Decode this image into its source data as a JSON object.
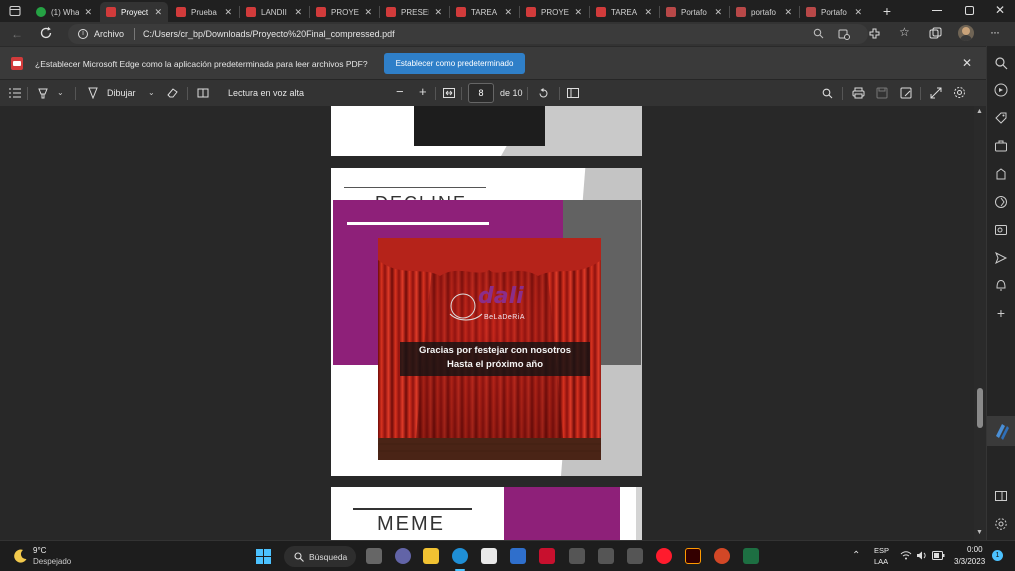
{
  "tabs": [
    {
      "title": "(1) Wha",
      "icon": "whatsapp-icon",
      "color": "#25a244",
      "active": false
    },
    {
      "title": "Proyect",
      "icon": "pdf-icon",
      "color": "#d13b3b",
      "active": true
    },
    {
      "title": "Prueba",
      "icon": "pdf-icon",
      "color": "#d13b3b",
      "active": false
    },
    {
      "title": "LANDII",
      "icon": "pdf-icon",
      "color": "#d13b3b",
      "active": false
    },
    {
      "title": "PROYE",
      "icon": "pdf-icon",
      "color": "#d13b3b",
      "active": false
    },
    {
      "title": "PRESEI",
      "icon": "pdf-icon",
      "color": "#d13b3b",
      "active": false
    },
    {
      "title": "TAREA",
      "icon": "pdf-icon",
      "color": "#d13b3b",
      "active": false
    },
    {
      "title": "PROYE",
      "icon": "pdf-icon",
      "color": "#d13b3b",
      "active": false
    },
    {
      "title": "TAREA",
      "icon": "pdf-icon",
      "color": "#d13b3b",
      "active": false
    },
    {
      "title": "Portafo",
      "icon": "shield-icon",
      "color": "#b84848",
      "active": false
    },
    {
      "title": "portafo",
      "icon": "shield-icon",
      "color": "#b84848",
      "active": false
    },
    {
      "title": "Portafo",
      "icon": "shield-icon",
      "color": "#b84848",
      "active": false
    }
  ],
  "address": {
    "scheme_label": "Archivo",
    "url": "C:/Users/cr_bp/Downloads/Proyecto%20Final_compressed.pdf"
  },
  "infobar": {
    "message": "¿Establecer Microsoft Edge como la aplicación predeterminada para leer archivos PDF?",
    "button_label": "Establecer como predeterminado"
  },
  "pdf_toolbar": {
    "draw_label": "Dibujar",
    "read_aloud_label": "Lectura en voz alta",
    "current_page": "8",
    "page_of": "de 10"
  },
  "pages": {
    "page8_heading": "DECLINE",
    "poster_brand": "BeLaDeRiA",
    "poster_logo_word": "dali",
    "poster_line1": "Gracias por festejar con nosotros",
    "poster_line2": "Hasta el próximo año",
    "page9_heading": "MEME"
  },
  "taskbar": {
    "weather_temp": "9°C",
    "weather_desc": "Despejado",
    "search_label": "Búsqueda",
    "lang_top": "ESP",
    "lang_bottom": "LAA",
    "time": "0:00",
    "date": "3/3/2023",
    "notification_count": "1"
  },
  "colors": {
    "accent_blue": "#2f7fc8",
    "magenta": "#8e2079",
    "curtain_red": "#c0201c"
  }
}
